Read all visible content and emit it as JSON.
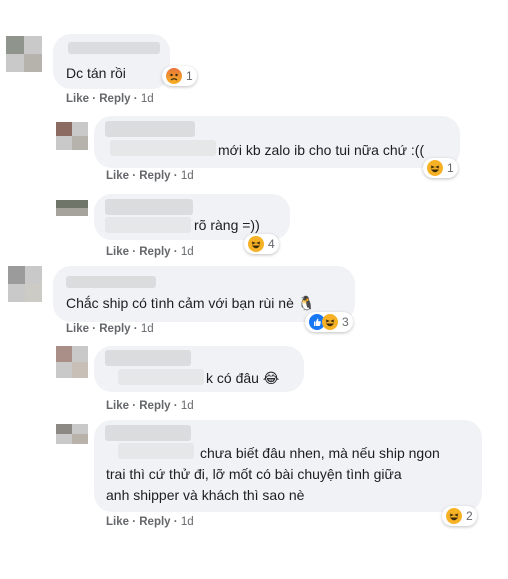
{
  "comments": [
    {
      "text": "Dc tán rồi",
      "actions": {
        "like": "Like",
        "reply": "Reply",
        "time": "1d"
      },
      "reaction": {
        "icons": [
          "angry-icon"
        ],
        "count": "1"
      }
    },
    {
      "text": "mới kb zalo ib cho tui nữa chứ :((",
      "actions": {
        "like": "Like",
        "reply": "Reply",
        "time": "1d"
      },
      "reaction": {
        "icons": [
          "haha-icon"
        ],
        "count": "1"
      }
    },
    {
      "text": "rõ ràng =))",
      "actions": {
        "like": "Like",
        "reply": "Reply",
        "time": "1d"
      },
      "reaction": {
        "icons": [
          "haha-icon"
        ],
        "count": "4"
      }
    },
    {
      "text": "Chắc ship có tình cảm với bạn rùi nè 🐧",
      "actions": {
        "like": "Like",
        "reply": "Reply",
        "time": "1d"
      },
      "reaction": {
        "icons": [
          "like-icon",
          "haha-icon"
        ],
        "count": "3"
      }
    },
    {
      "text": "k có đâu 😂",
      "actions": {
        "like": "Like",
        "reply": "Reply",
        "time": "1d"
      }
    },
    {
      "text_lines": [
        "chưa biết đâu nhen, mà nếu ship ngon",
        "trai thì cứ thử đi, lỡ mốt có bài chuyện tình giữa",
        "anh shipper và khách thì sao nè"
      ],
      "actions": {
        "like": "Like",
        "reply": "Reply",
        "time": "1d"
      },
      "reaction": {
        "icons": [
          "haha-icon"
        ],
        "count": "2"
      }
    }
  ]
}
